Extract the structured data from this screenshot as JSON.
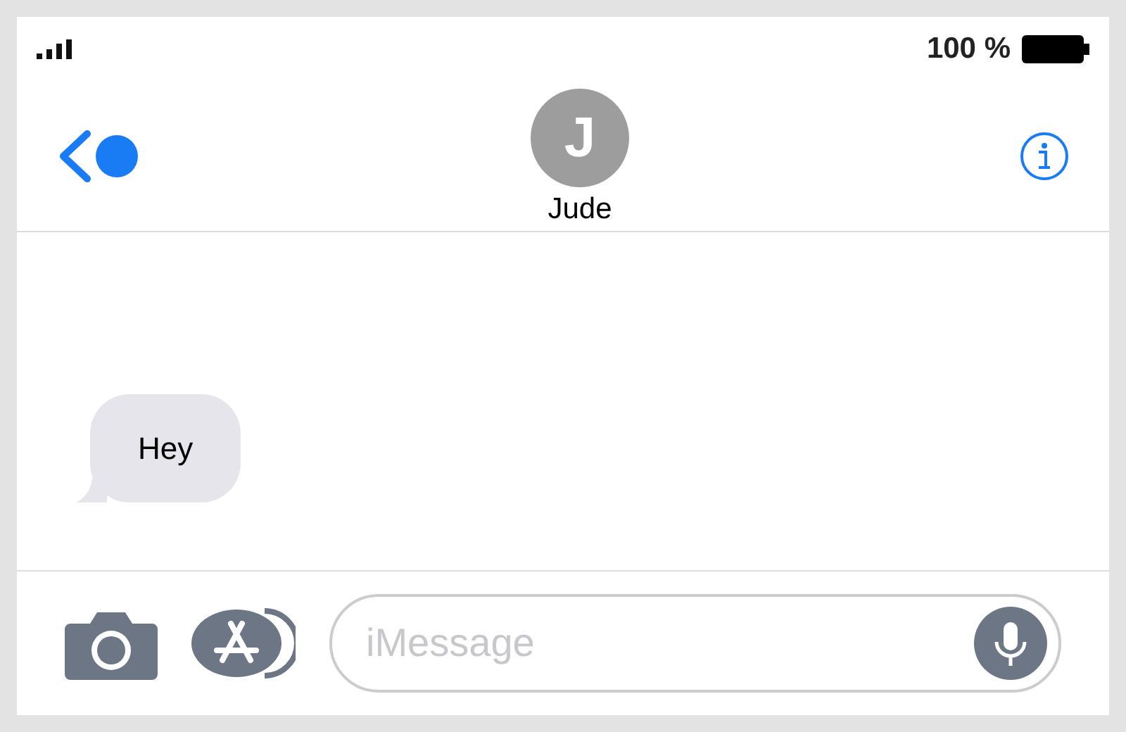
{
  "status_bar": {
    "battery_text": "100 %"
  },
  "contact": {
    "initial": "J",
    "name": "Jude"
  },
  "messages": [
    {
      "text": "Hey",
      "kind": "received"
    }
  ],
  "composer": {
    "placeholder": "iMessage"
  }
}
